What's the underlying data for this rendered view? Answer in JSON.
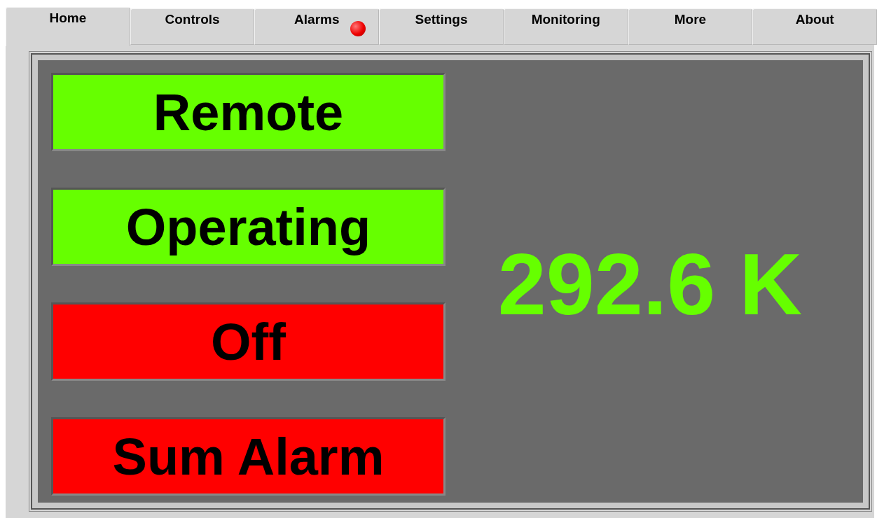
{
  "tabs": [
    {
      "label": "Home",
      "selected": true,
      "alarm": false
    },
    {
      "label": "Controls",
      "selected": false,
      "alarm": false
    },
    {
      "label": "Alarms",
      "selected": false,
      "alarm": true
    },
    {
      "label": "Settings",
      "selected": false,
      "alarm": false
    },
    {
      "label": "Monitoring",
      "selected": false,
      "alarm": false
    },
    {
      "label": "More",
      "selected": false,
      "alarm": false
    },
    {
      "label": "About",
      "selected": false,
      "alarm": false
    }
  ],
  "indicators": [
    {
      "label": "Remote",
      "color": "#66ff00"
    },
    {
      "label": "Operating",
      "color": "#66ff00"
    },
    {
      "label": "Off",
      "color": "#ff0000"
    },
    {
      "label": "Sum Alarm",
      "color": "#ff0000"
    }
  ],
  "temperature": "292.6 K"
}
